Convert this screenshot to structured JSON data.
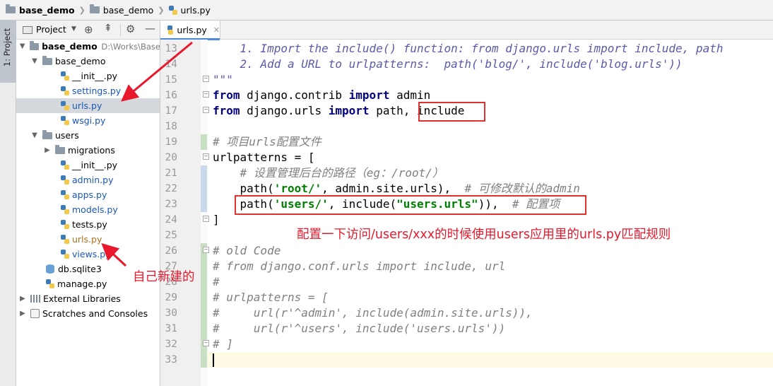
{
  "breadcrumb": {
    "items": [
      "base_demo",
      "base_demo",
      "urls.py"
    ]
  },
  "toolstrip": {
    "project_tab": "1: Project"
  },
  "project_panel": {
    "title": "Project",
    "tree": [
      {
        "label": "base_demo",
        "extra": "D:\\Works\\Base",
        "kind": "folder",
        "bold": true
      },
      {
        "label": "base_demo",
        "kind": "folder"
      },
      {
        "label": "__init__.py",
        "kind": "py"
      },
      {
        "label": "settings.py",
        "kind": "py"
      },
      {
        "label": "urls.py",
        "kind": "py"
      },
      {
        "label": "wsgi.py",
        "kind": "py"
      },
      {
        "label": "users",
        "kind": "folder"
      },
      {
        "label": "migrations",
        "kind": "folder"
      },
      {
        "label": "__init__.py",
        "kind": "py"
      },
      {
        "label": "admin.py",
        "kind": "py"
      },
      {
        "label": "apps.py",
        "kind": "py"
      },
      {
        "label": "models.py",
        "kind": "py"
      },
      {
        "label": "tests.py",
        "kind": "py"
      },
      {
        "label": "urls.py",
        "kind": "py"
      },
      {
        "label": "views.py",
        "kind": "py"
      },
      {
        "label": "db.sqlite3",
        "kind": "db"
      },
      {
        "label": "manage.py",
        "kind": "py"
      },
      {
        "label": "External Libraries",
        "kind": "lib"
      },
      {
        "label": "Scratches and Consoles",
        "kind": "scratch"
      }
    ]
  },
  "editor": {
    "tab_label": "urls.py",
    "line_numbers": [
      "13",
      "14",
      "15",
      "16",
      "17",
      "18",
      "19",
      "20",
      "21",
      "22",
      "23",
      "24",
      "25",
      "26",
      "27",
      "28",
      "29",
      "30",
      "31",
      "32",
      "33"
    ],
    "code": {
      "l13": "    1. Import the include() function: from django.urls import include, path",
      "l14": "    2. Add a URL to urlpatterns:  path('blog/', include('blog.urls'))",
      "l15": "\"\"\"",
      "l16_kw1": "from",
      "l16_mid": " django.contrib ",
      "l16_kw2": "import",
      "l16_end": " admin",
      "l17_kw1": "from",
      "l17_mid": " django.urls ",
      "l17_kw2": "import",
      "l17_end": " path, include",
      "l19": "# 项目urls配置文件",
      "l20": "urlpatterns = [",
      "l21": "    # 设置管理后台的路径（eg：/root/）",
      "l22_a": "    path(",
      "l22_s": "'root/'",
      "l22_b": ", admin.site.urls),  ",
      "l22_c": "# 可修改默认的admin",
      "l23_a": "    path(",
      "l23_s": "'users/'",
      "l23_b": ", include(",
      "l23_s2": "\"users.urls\"",
      "l23_c": ")),  ",
      "l23_d": "# 配置项",
      "l24": "]",
      "l26": "# old Code",
      "l27": "# from django.conf.urls import include, url",
      "l28": "#",
      "l29": "# urlpatterns = [",
      "l30": "#     url(r'^admin', include(admin.site.urls)),",
      "l31": "#     url(r'^users', include('users.urls'))",
      "l32": "# ]"
    }
  },
  "annotations": {
    "main": "配置一下访问/users/xxx的时候使用users应用里的urls.py匹配规则",
    "self_created": "自己新建的"
  },
  "colors": {
    "annotation_red": "#e8192c",
    "selection": "#d5d9de",
    "keyword": "#000080"
  }
}
